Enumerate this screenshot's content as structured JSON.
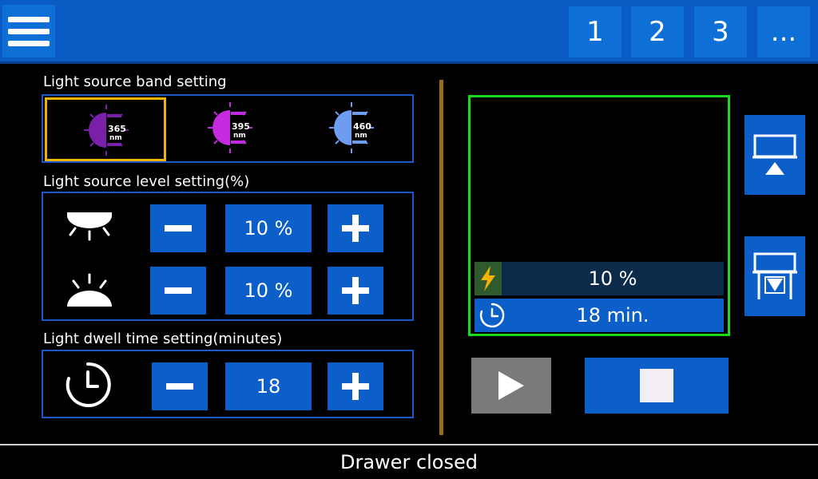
{
  "header": {
    "tabs": [
      {
        "label": "1"
      },
      {
        "label": "2"
      },
      {
        "label": "3"
      },
      {
        "label": "..."
      }
    ]
  },
  "band": {
    "title": "Light source band setting",
    "options": [
      {
        "value": "365",
        "unit": "nm",
        "color": "#7a1fa8",
        "selected": true
      },
      {
        "value": "395",
        "unit": "nm",
        "color": "#c42ae0",
        "selected": false
      },
      {
        "value": "460",
        "unit": "nm",
        "color": "#6e9cf0",
        "selected": false
      }
    ]
  },
  "level": {
    "title": "Light source level setting(%)",
    "top_value": "10 %",
    "bottom_value": "10 %"
  },
  "dwell": {
    "title": "Light dwell time setting(minutes)",
    "value": "18"
  },
  "preview": {
    "level": "10 %",
    "time": "18 min."
  },
  "status": {
    "text": "Drawer closed"
  },
  "colors": {
    "accent": "#0c5fc8",
    "selected_border": "#f0b400",
    "preview_border": "#1ed81e",
    "divider": "#9a6a1e"
  }
}
